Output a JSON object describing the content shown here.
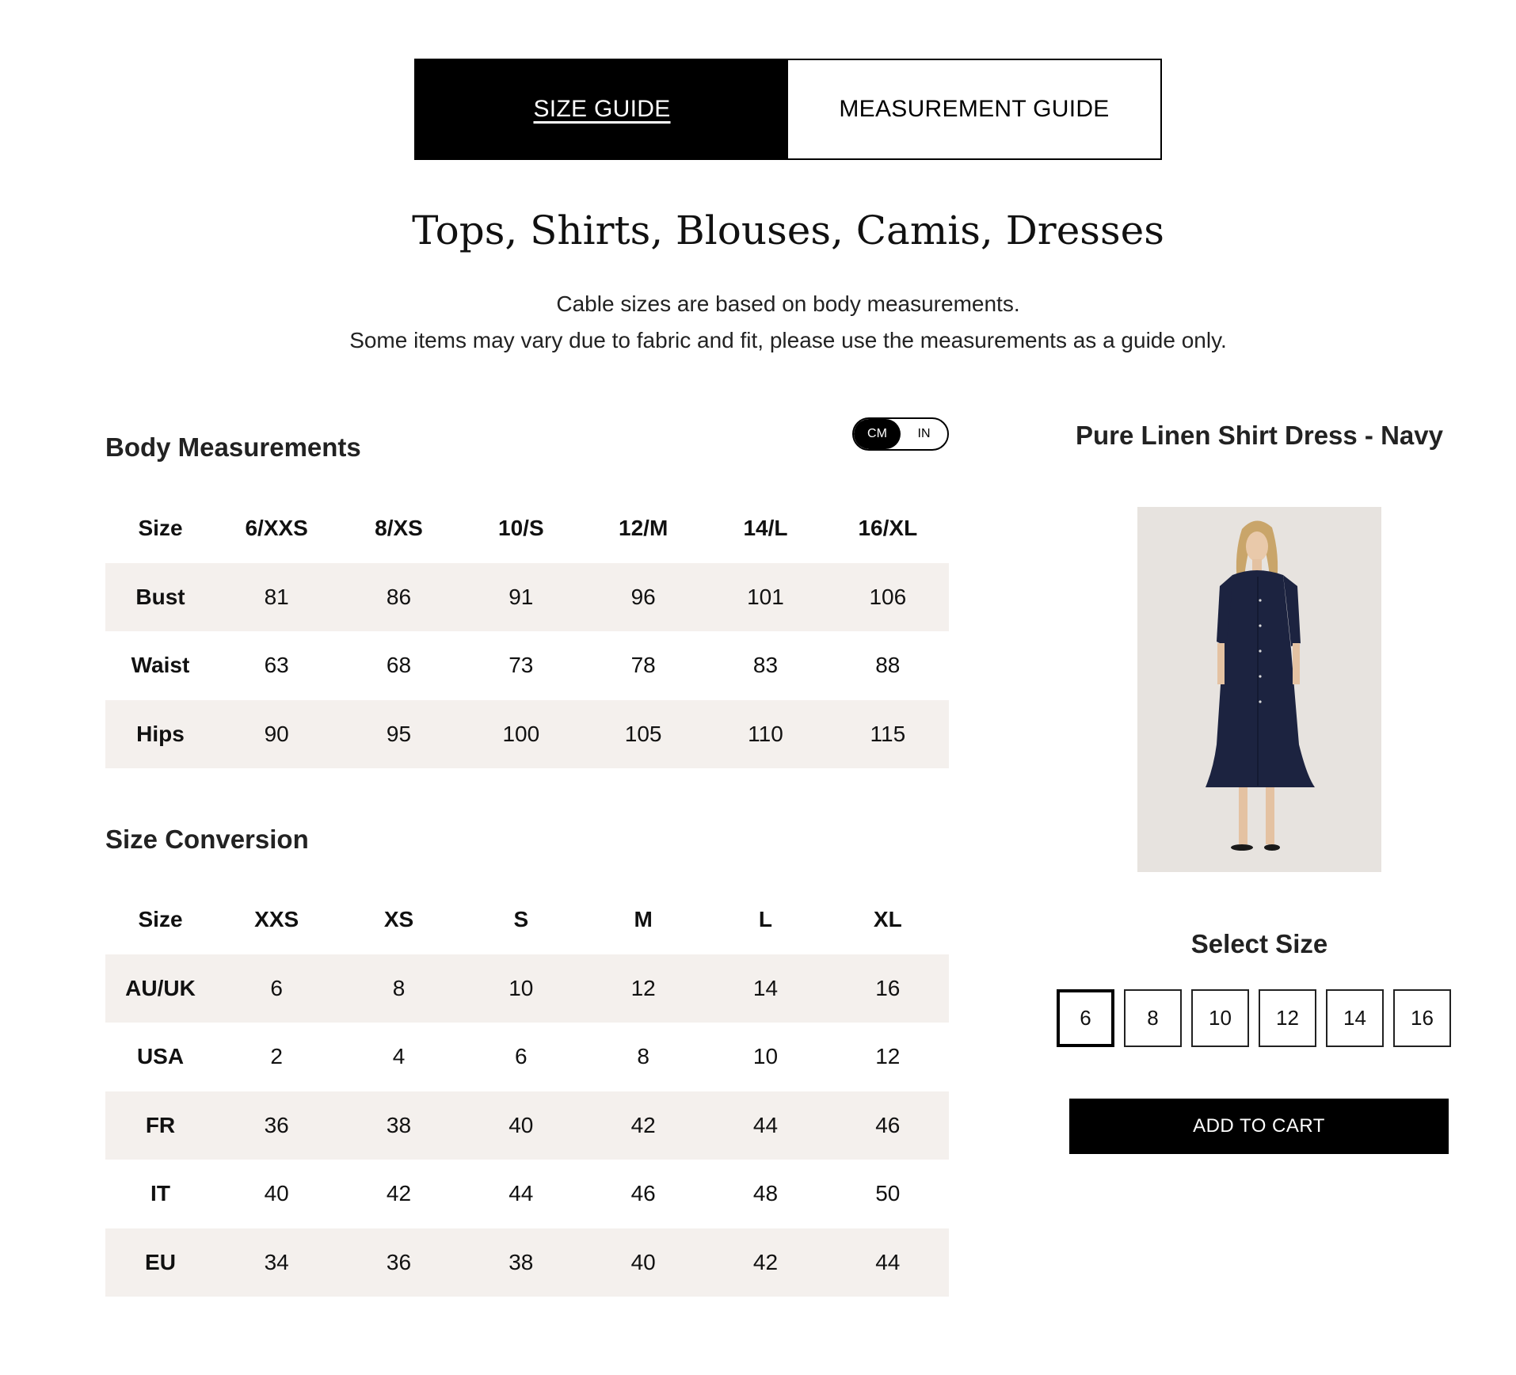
{
  "tabs": [
    {
      "label": "SIZE GUIDE",
      "active": true
    },
    {
      "label": "MEASUREMENT GUIDE",
      "active": false
    }
  ],
  "title": "Tops, Shirts, Blouses, Camis, Dresses",
  "subtitle_lines": [
    "Cable sizes are based on body measurements.",
    "Some items may vary due to fabric and fit, please use the measurements as a guide only."
  ],
  "body_measurements": {
    "heading": "Body Measurements",
    "unit_toggle": {
      "options": [
        "CM",
        "IN"
      ],
      "selected": "CM"
    },
    "headers": [
      "Size",
      "6/XXS",
      "8/XS",
      "10/S",
      "12/M",
      "14/L",
      "16/XL"
    ],
    "rows": [
      {
        "label": "Bust",
        "values": [
          "81",
          "86",
          "91",
          "96",
          "101",
          "106"
        ]
      },
      {
        "label": "Waist",
        "values": [
          "63",
          "68",
          "73",
          "78",
          "83",
          "88"
        ]
      },
      {
        "label": "Hips",
        "values": [
          "90",
          "95",
          "100",
          "105",
          "110",
          "115"
        ]
      }
    ]
  },
  "size_conversion": {
    "heading": "Size Conversion",
    "headers": [
      "Size",
      "XXS",
      "XS",
      "S",
      "M",
      "L",
      "XL"
    ],
    "rows": [
      {
        "label": "AU/UK",
        "values": [
          "6",
          "8",
          "10",
          "12",
          "14",
          "16"
        ]
      },
      {
        "label": "USA",
        "values": [
          "2",
          "4",
          "6",
          "8",
          "10",
          "12"
        ]
      },
      {
        "label": "FR",
        "values": [
          "36",
          "38",
          "40",
          "42",
          "44",
          "46"
        ]
      },
      {
        "label": "IT",
        "values": [
          "40",
          "42",
          "44",
          "46",
          "48",
          "50"
        ]
      },
      {
        "label": "EU",
        "values": [
          "34",
          "36",
          "38",
          "40",
          "42",
          "44"
        ]
      }
    ]
  },
  "product": {
    "name": "Pure Linen Shirt Dress - Navy",
    "select_size_label": "Select Size",
    "sizes": [
      "6",
      "8",
      "10",
      "12",
      "14",
      "16"
    ],
    "selected_size": "6",
    "add_to_cart_label": "ADD TO CART",
    "dress_color": "#1c2340"
  },
  "colors": {
    "shaded_row": "#f4f0ed",
    "accent": "#000000",
    "image_bg": "#e7e3df"
  }
}
